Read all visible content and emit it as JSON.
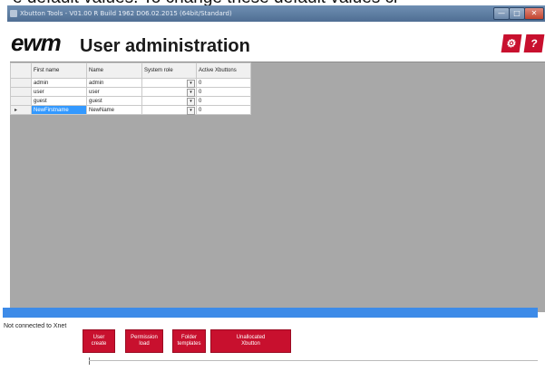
{
  "background_caption": "e default values. To change these default values cl",
  "window": {
    "title": "Xbutton Tools - V01.00 R Build 1962 D06.02.2015 (64bit/Standard)",
    "controls": {
      "minimize": "—",
      "maximize": "□",
      "close": "✕"
    }
  },
  "header": {
    "logo": "ewm",
    "title": "User administration",
    "gear_button": "⚙",
    "help_button": "?"
  },
  "users_table": {
    "columns": [
      "First name",
      "Name",
      "System role",
      "Active Xbuttons"
    ],
    "rows": [
      {
        "first_name": "admin",
        "name": "admin",
        "system_role": "",
        "active_xbuttons": "0"
      },
      {
        "first_name": "user",
        "name": "user",
        "system_role": "",
        "active_xbuttons": "0"
      },
      {
        "first_name": "guest",
        "name": "guest",
        "system_role": "",
        "active_xbuttons": "0"
      },
      {
        "first_name": "NewFirstname",
        "name": "NewName",
        "system_role": "",
        "active_xbuttons": "0"
      }
    ],
    "current_row_marker": "▸",
    "dropdown_glyph": "▾"
  },
  "status": {
    "text": "Not connected to Xnet"
  },
  "actions": {
    "user_create": [
      "User",
      "create"
    ],
    "permission_load": [
      "Permission",
      "load"
    ],
    "folder_templates": [
      "Folder",
      "templates"
    ],
    "unallocated_xbutton": [
      "Unallocated",
      "Xbutton"
    ]
  },
  "colors": {
    "brand_red": "#c8102e",
    "titlebar_blue": "#5a7aa0",
    "progress_blue": "#3d8be8",
    "workspace_gray": "#a8a8a8",
    "selection_blue": "#3399ff"
  }
}
